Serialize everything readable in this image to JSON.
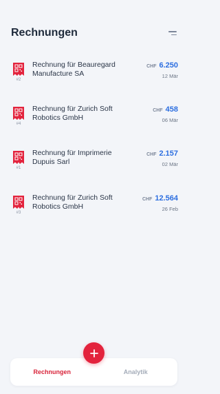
{
  "header": {
    "title": "Rechnungen",
    "menu_icon": "menu-icon"
  },
  "colors": {
    "accent": "#e3233d",
    "amount": "#2c6ee0",
    "background": "#f3f5f9"
  },
  "invoices": [
    {
      "name": "Rechnung für Beauregard Manufacture SA",
      "number": "#2",
      "currency": "CHF",
      "amount": "6.250",
      "date": "12 Mär"
    },
    {
      "name": "Rechnung für Zurich Soft Robotics GmbH",
      "number": "#4",
      "currency": "CHF",
      "amount": "458",
      "date": "06 Mär"
    },
    {
      "name": "Rechnung für Imprimerie Dupuis Sarl",
      "number": "#1",
      "currency": "CHF",
      "amount": "2.157",
      "date": "02 Mär"
    },
    {
      "name": "Rechnung für Zurich Soft Robotics GmbH",
      "number": "#3",
      "currency": "CHF",
      "amount": "12.564",
      "date": "26 Feb"
    }
  ],
  "fab": {
    "icon": "plus-icon"
  },
  "tabs": [
    {
      "label": "Rechnungen",
      "active": true
    },
    {
      "label": "Analytik",
      "active": false
    }
  ]
}
